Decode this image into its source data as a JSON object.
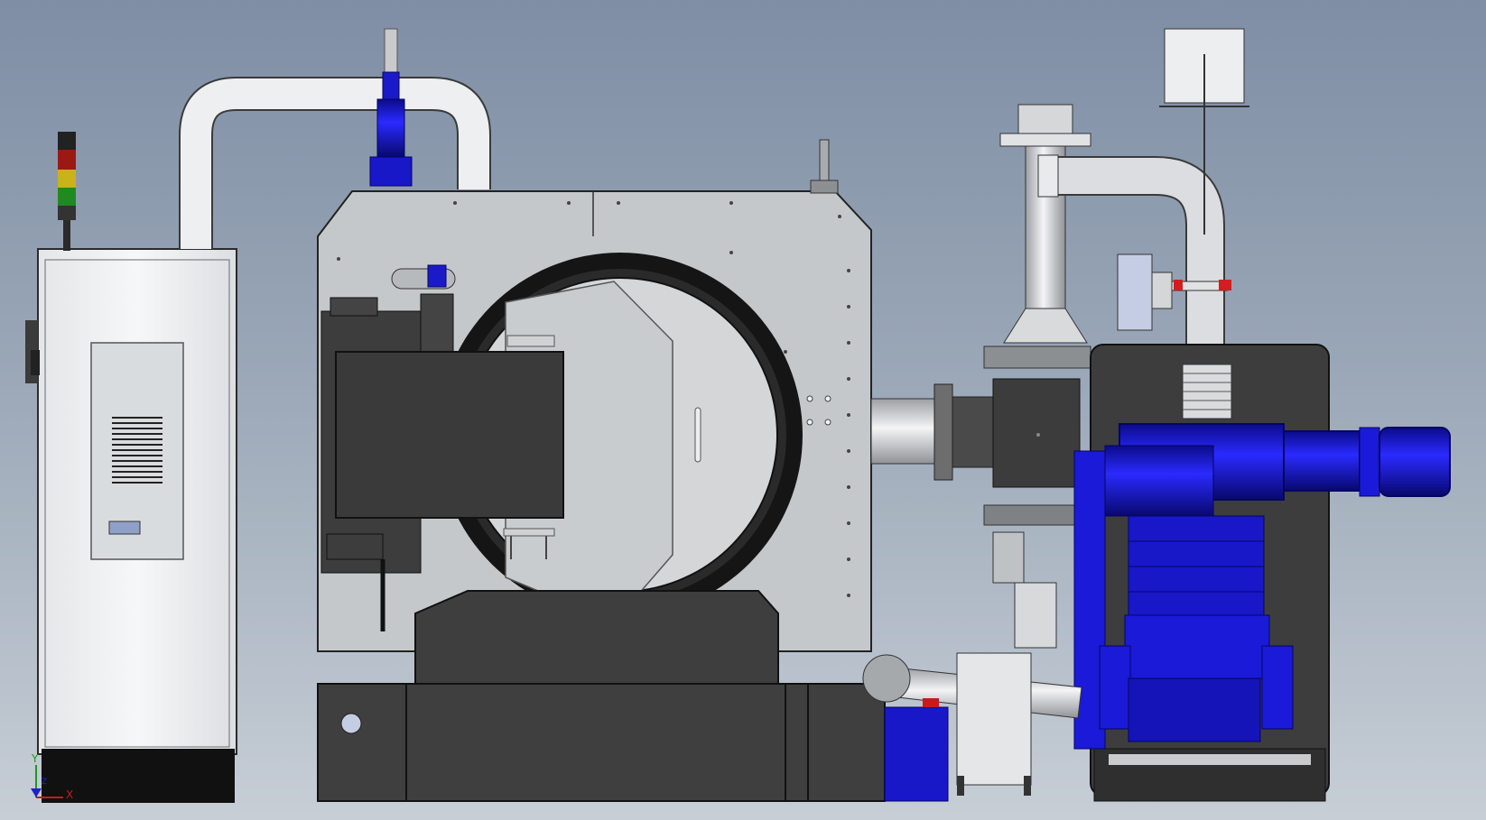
{
  "viewport": {
    "background_top": "#7f8ea5",
    "background_bottom": "#c7ced6"
  },
  "triad": {
    "x_label": "X",
    "y_label": "Y",
    "z_label": "Z"
  },
  "colors": {
    "cabinet": "#f2f3f4",
    "chamber_gray": "#c5c8ca",
    "dark_gray": "#4a4a4a",
    "pump_blue": "#1414e0",
    "pipe_silver": "#d6d7d9",
    "beacon_red": "#9a1a12",
    "beacon_yellow": "#c9b21a",
    "beacon_green": "#1f8a1f"
  }
}
